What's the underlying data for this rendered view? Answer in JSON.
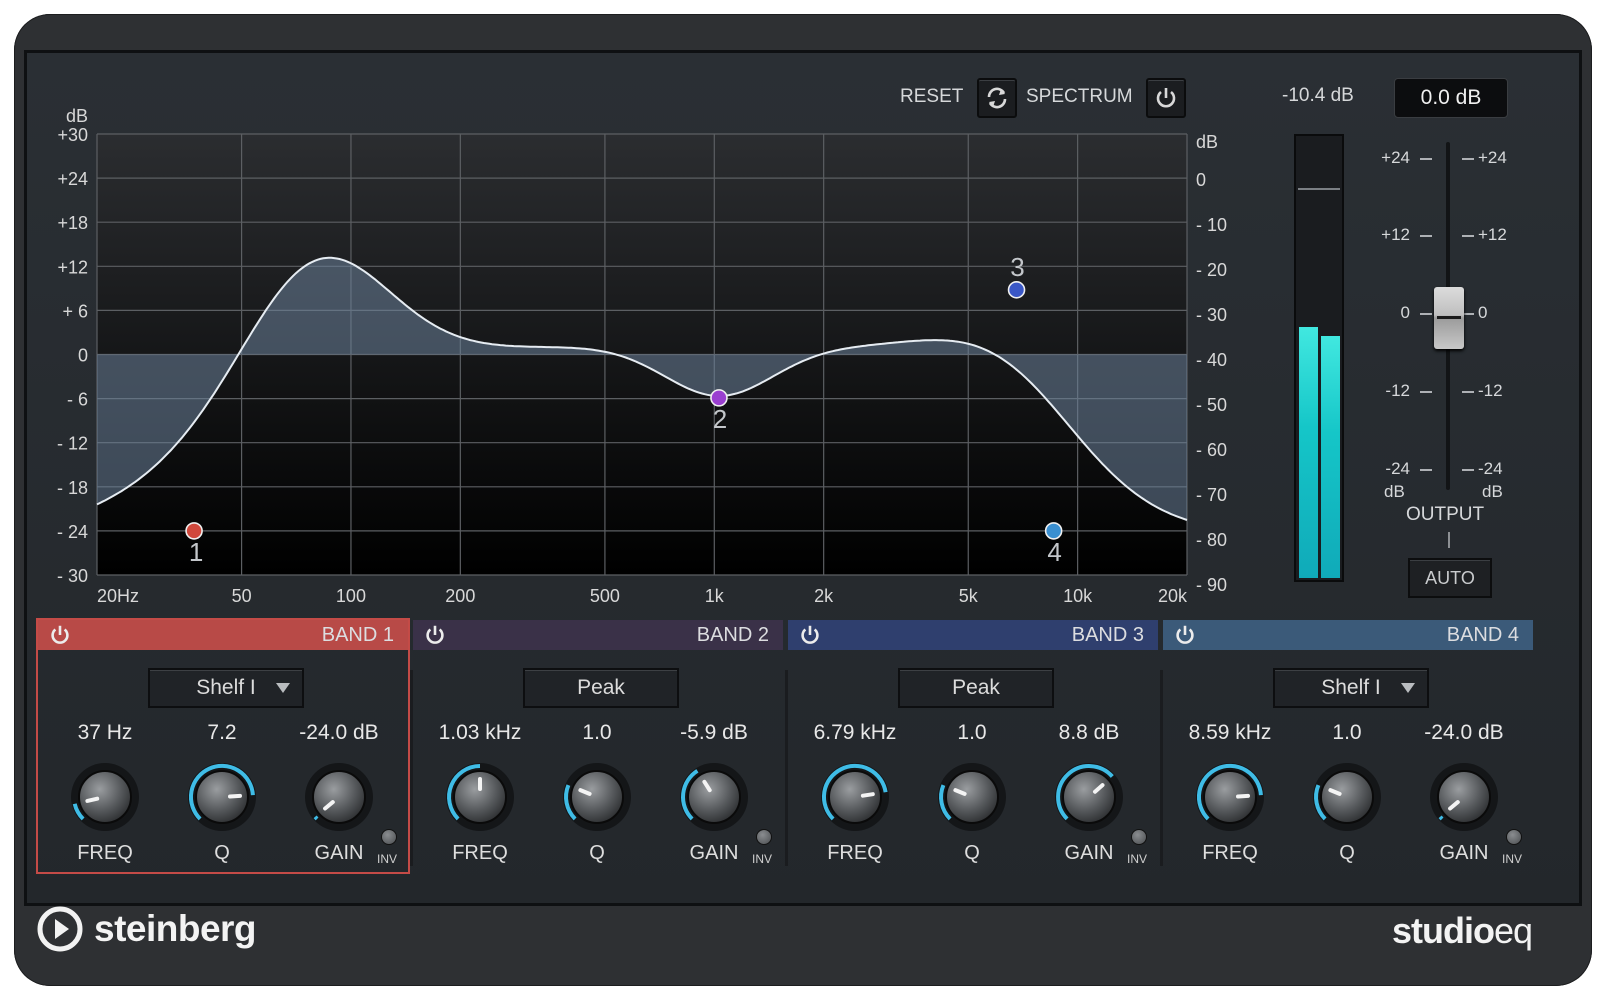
{
  "header": {
    "reset_label": "RESET",
    "spectrum_label": "SPECTRUM",
    "peak_readout": "-10.4 dB",
    "output_value": "0.0 dB"
  },
  "graph": {
    "left_unit": "dB",
    "right_unit": "dB",
    "left_ticks": [
      "+30",
      "+24",
      "+18",
      "+12",
      "+ 6",
      "0",
      "- 6",
      "- 12",
      "- 18",
      "- 24",
      "- 30"
    ],
    "right_ticks": [
      "0",
      "- 10",
      "- 20",
      "- 30",
      "- 40",
      "- 50",
      "- 60",
      "- 70",
      "- 80",
      "- 90"
    ],
    "freq_ticks": [
      "20Hz",
      "50",
      "100",
      "200",
      "500",
      "1k",
      "2k",
      "5k",
      "10k",
      "20k"
    ],
    "nodes": [
      {
        "id": "1",
        "color": "#d0483c",
        "freq_hz": 37,
        "gain_db": -24.0
      },
      {
        "id": "2",
        "color": "#9a3fd0",
        "freq_hz": 1030,
        "gain_db": -5.9
      },
      {
        "id": "3",
        "color": "#3a57c6",
        "freq_hz": 6790,
        "gain_db": 8.8
      },
      {
        "id": "4",
        "color": "#3a8fd0",
        "freq_hz": 8590,
        "gain_db": -24.0
      }
    ]
  },
  "meter": {
    "left_level": 0.57,
    "right_level": 0.55
  },
  "output": {
    "scale_left": [
      "+24",
      "+12",
      "0",
      "-12",
      "-24"
    ],
    "scale_right": [
      "+24",
      "+12",
      "0",
      "-12",
      "-24"
    ],
    "unit": "dB",
    "label": "OUTPUT",
    "auto_label": "AUTO"
  },
  "bands": [
    {
      "title": "BAND 1",
      "type": "Shelf I",
      "has_dropdown": true,
      "freq": "37 Hz",
      "q": "7.2",
      "gain": "-24.0 dB",
      "head_color": "#b84a47",
      "freq_pos": 0.12,
      "q_pos": 0.82,
      "gain_pos": 0.02
    },
    {
      "title": "BAND 2",
      "type": "Peak",
      "has_dropdown": false,
      "freq": "1.03 kHz",
      "q": "1.0",
      "gain": "-5.9 dB",
      "head_color": "#3a3148",
      "freq_pos": 0.5,
      "q_pos": 0.25,
      "gain_pos": 0.38
    },
    {
      "title": "BAND 3",
      "type": "Peak",
      "has_dropdown": false,
      "freq": "6.79 kHz",
      "q": "1.0",
      "gain": "8.8 dB",
      "head_color": "#2f3f6e",
      "freq_pos": 0.8,
      "q_pos": 0.25,
      "gain_pos": 0.68
    },
    {
      "title": "BAND 4",
      "type": "Shelf I",
      "has_dropdown": true,
      "freq": "8.59 kHz",
      "q": "1.0",
      "gain": "-24.0 dB",
      "head_color": "#3b5a79",
      "freq_pos": 0.82,
      "q_pos": 0.25,
      "gain_pos": 0.02
    }
  ],
  "knob_labels": {
    "freq": "FREQ",
    "q": "Q",
    "gain": "GAIN",
    "inv": "INV"
  },
  "footer": {
    "brand": "steinberg",
    "product_a": "studio",
    "product_b": "eq"
  }
}
